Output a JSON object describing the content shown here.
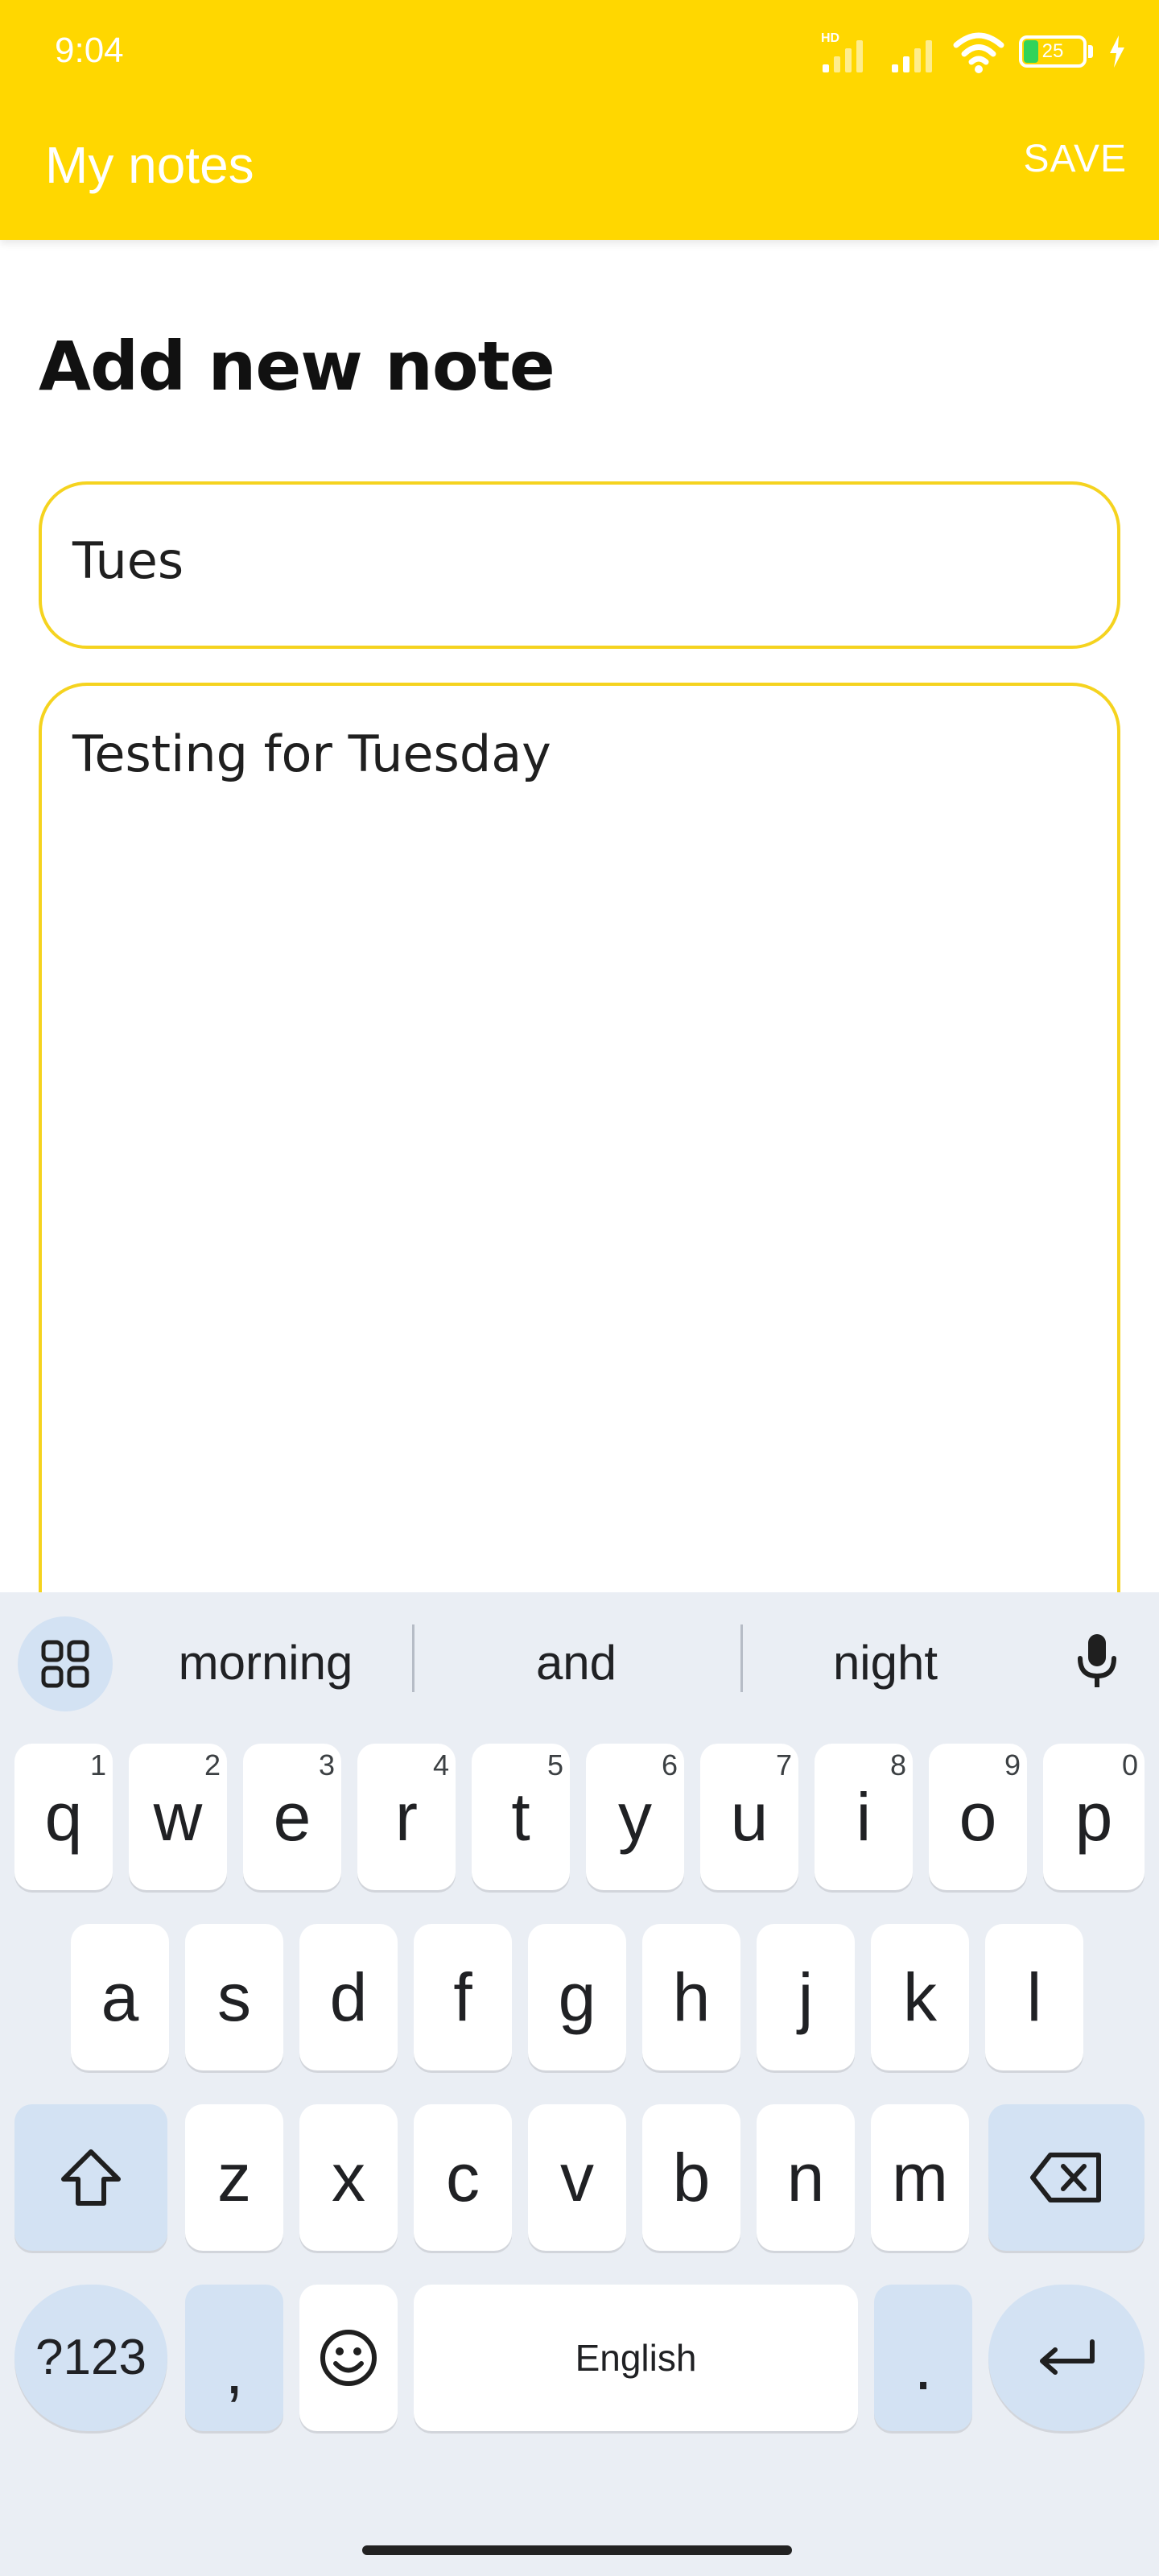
{
  "status_bar": {
    "time": "9:04",
    "network_badge": "HD",
    "battery_percent": "25",
    "battery_level": 0.25,
    "icons": [
      "hd-signal-icon",
      "signal-icon",
      "wifi-icon",
      "battery-icon",
      "charging-bolt-icon"
    ]
  },
  "app_bar": {
    "title": "My notes",
    "save_label": "SAVE",
    "background_color": "#FFD700"
  },
  "main": {
    "heading": "Add new note",
    "title_value": "Tues",
    "body_value": "Testing for Tuesday",
    "field_border_color": "#F5D31F"
  },
  "keyboard": {
    "suggestions": [
      "morning",
      "and",
      "night"
    ],
    "row1": [
      {
        "label": "q",
        "num": "1"
      },
      {
        "label": "w",
        "num": "2"
      },
      {
        "label": "e",
        "num": "3"
      },
      {
        "label": "r",
        "num": "4"
      },
      {
        "label": "t",
        "num": "5"
      },
      {
        "label": "y",
        "num": "6"
      },
      {
        "label": "u",
        "num": "7"
      },
      {
        "label": "i",
        "num": "8"
      },
      {
        "label": "o",
        "num": "9"
      },
      {
        "label": "p",
        "num": "0"
      }
    ],
    "row2": [
      "a",
      "s",
      "d",
      "f",
      "g",
      "h",
      "j",
      "k",
      "l"
    ],
    "row3": [
      "z",
      "x",
      "c",
      "v",
      "b",
      "n",
      "m"
    ],
    "symbols_label": "?123",
    "comma_label": ",",
    "space_label": "English",
    "period_label": ".",
    "background_color": "#EAEEF4",
    "special_key_color": "#D3E2F3"
  }
}
